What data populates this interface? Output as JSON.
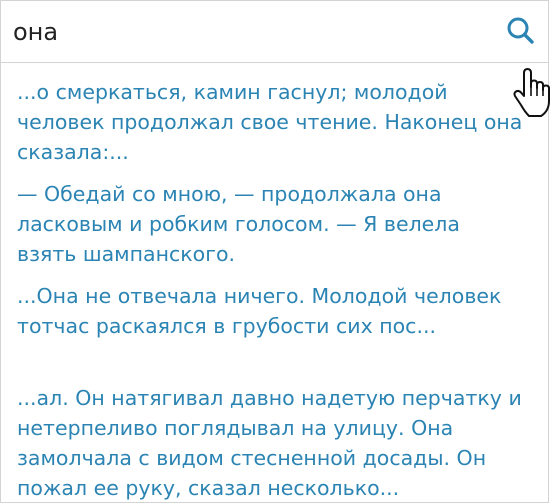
{
  "search": {
    "value": "она",
    "icon": "search-icon",
    "accent_color": "#2b84b3"
  },
  "cursor": {
    "icon": "hand-pointer-icon"
  },
  "results": [
    {
      "text": "...о смеркаться, камин гаснул; молодой человек продолжал свое чтение. Наконец она сказала:..."
    },
    {
      "text": "— Обедай со мною, — продолжала она ласковым и робким голосом. — Я велела взять шампанского."
    },
    {
      "text": "...Она не отвечала ничего. Молодой человек тотчас раскаялся в грубости сих пос..."
    },
    {
      "text": "...ал. Он натягивал давно надетую перчатку и нетерпеливо поглядывал на улицу. Она замолчала с видом стесненной досады. Он пожал ее руку, сказал несколько..."
    }
  ]
}
